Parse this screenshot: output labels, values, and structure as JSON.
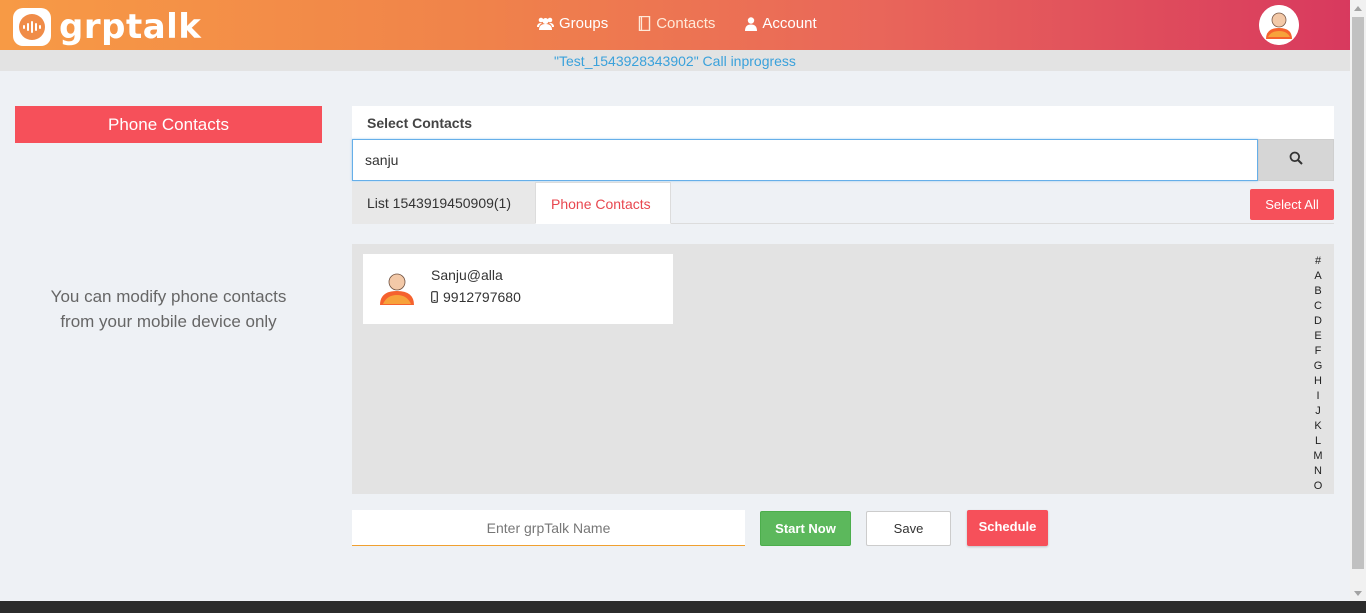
{
  "header": {
    "logo_text": "grptalk",
    "nav": [
      {
        "label": "Groups",
        "icon": "users-icon"
      },
      {
        "label": "Contacts",
        "icon": "address-book-icon"
      },
      {
        "label": "Account",
        "icon": "user-icon"
      }
    ]
  },
  "status": {
    "text": "\"Test_1543928343902\" Call inprogress"
  },
  "left_panel": {
    "title": "Phone Contacts",
    "note_line1": "You can modify phone contacts",
    "note_line2": "from your mobile device only"
  },
  "select_contacts": {
    "title": "Select Contacts",
    "search_value": "sanju",
    "tabs": [
      {
        "label": "List 1543919450909(1)"
      },
      {
        "label": "Phone Contacts"
      }
    ],
    "select_all_label": "Select All"
  },
  "contacts": [
    {
      "name": "Sanju@alla",
      "phone": "9912797680"
    }
  ],
  "alpha_index": [
    "#",
    "A",
    "B",
    "C",
    "D",
    "E",
    "F",
    "G",
    "H",
    "I",
    "J",
    "K",
    "L",
    "M",
    "N",
    "O"
  ],
  "footer_actions": {
    "name_placeholder": "Enter grpTalk Name",
    "start_label": "Start Now",
    "save_label": "Save",
    "schedule_label": "Schedule"
  },
  "colors": {
    "accent_red": "#f6505a",
    "start_green": "#5cb85c",
    "status_blue": "#3aa1db"
  }
}
